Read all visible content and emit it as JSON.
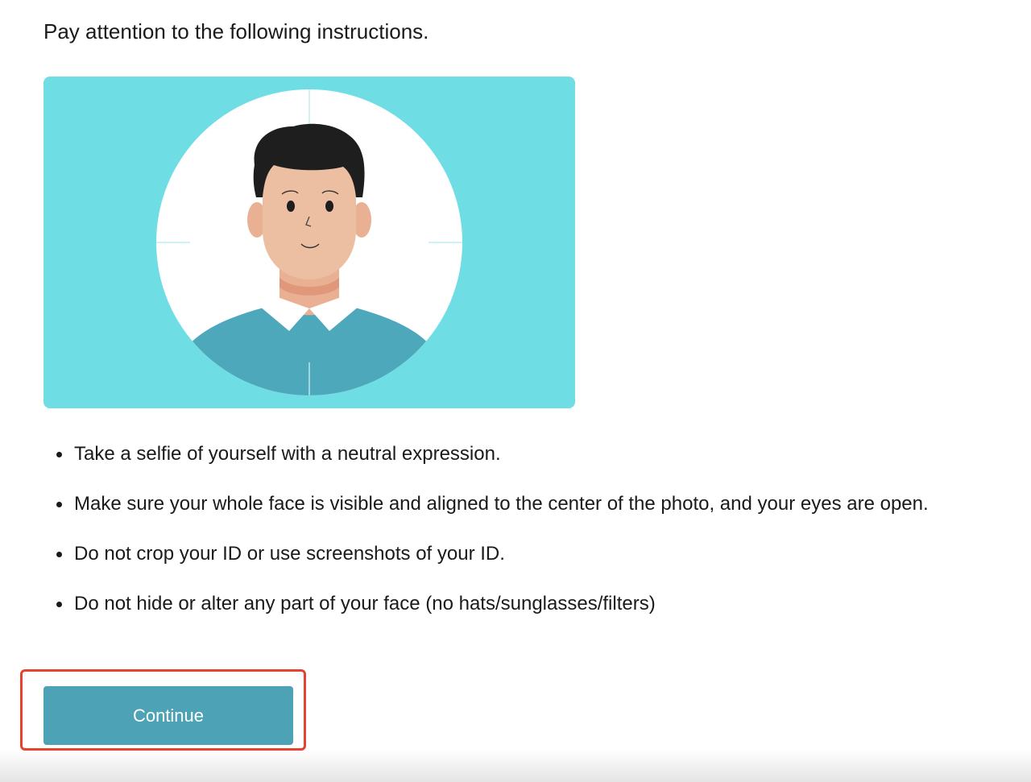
{
  "header": {
    "title": "Pay attention to the following instructions."
  },
  "illustration": {
    "icon": "selfie-portrait-illustration",
    "background_color": "#6fdde4"
  },
  "instructions": [
    "Take a selfie of yourself with a neutral expression.",
    "Make sure your whole face is visible and aligned to the center of the photo, and your eyes are open.",
    "Do not crop your ID or use screenshots of your ID.",
    "Do not hide or alter any part of your face (no hats/sunglasses/filters)"
  ],
  "actions": {
    "continue_label": "Continue",
    "continue_color": "#4da3b5",
    "highlight_color": "#e5432f"
  }
}
